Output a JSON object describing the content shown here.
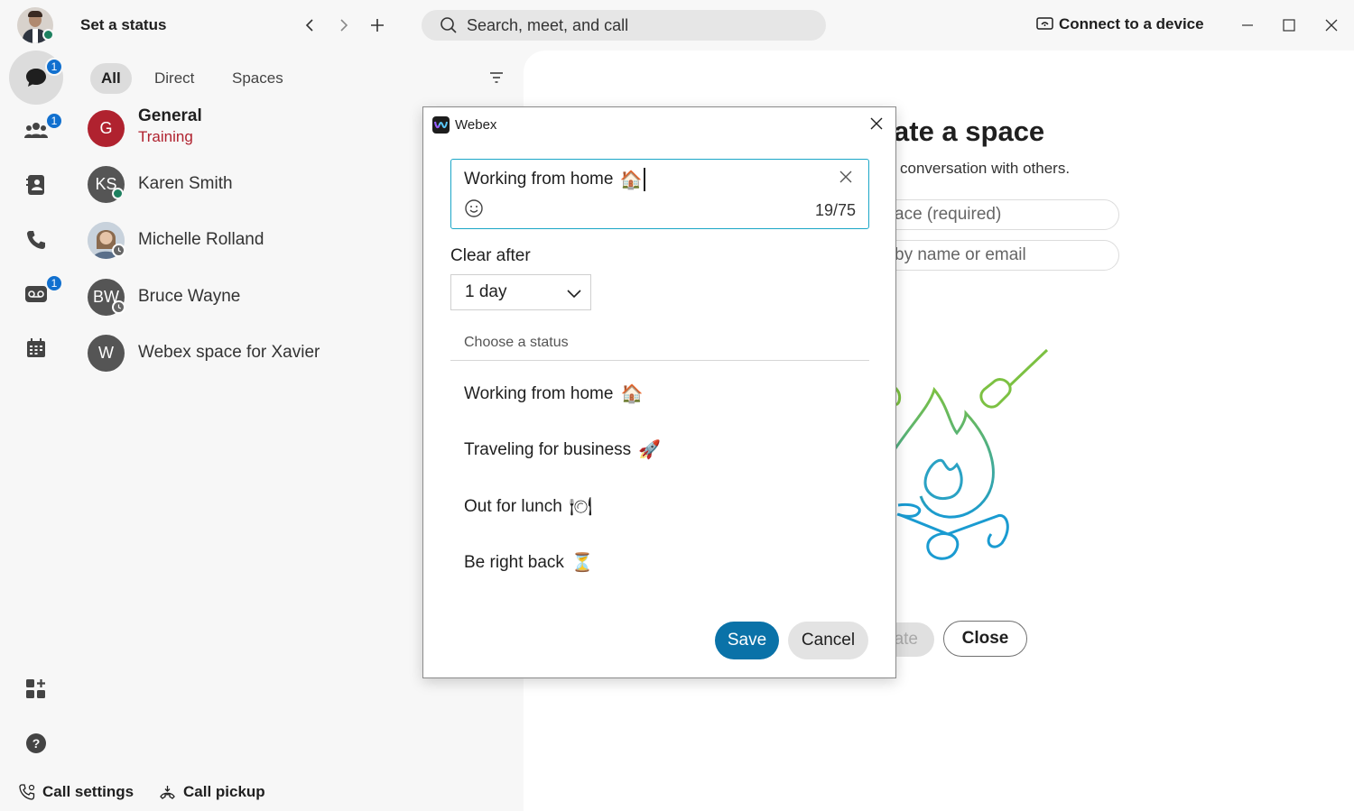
{
  "header": {
    "status_label": "Set a status",
    "search_placeholder": "Search, meet, and call",
    "connect_label": "Connect to a device"
  },
  "rail": {
    "messaging_badge": "1",
    "teams_badge": "1",
    "voicemail_badge": "1"
  },
  "filters": {
    "all": "All",
    "direct": "Direct",
    "spaces": "Spaces"
  },
  "conversations": [
    {
      "initials": "G",
      "name": "General",
      "sub": "Training",
      "color": "#b0222f"
    },
    {
      "initials": "KS",
      "name": "Karen Smith",
      "color": "#555555"
    },
    {
      "initials": "",
      "name": "Michelle Rolland",
      "color": "#9aa7b4"
    },
    {
      "initials": "BW",
      "name": "Bruce Wayne",
      "color": "#555555"
    },
    {
      "initials": "W",
      "name": "Webex space for Xavier",
      "color": "#555555"
    }
  ],
  "footer": {
    "call_settings": "Call settings",
    "call_pickup": "Call pickup"
  },
  "background": {
    "title": "ate a space",
    "subtitle": "conversation with others.",
    "space_name_placeholder": "ace (required)",
    "people_placeholder": "by name or email",
    "create_label": "ate",
    "close_label": "Close"
  },
  "dialog": {
    "title": "Webex",
    "status_value": "Working from home",
    "status_emoji": "🏠",
    "counter": "19/75",
    "clear_after_label": "Clear after",
    "clear_after_value": "1 day",
    "choose_label": "Choose a status",
    "options": [
      {
        "label": "Working from home",
        "emoji": "🏠"
      },
      {
        "label": "Traveling for business",
        "emoji": "🚀"
      },
      {
        "label": "Out for lunch",
        "emoji": "🍽"
      },
      {
        "label": "Be right back",
        "emoji": "⏳"
      }
    ],
    "save_label": "Save",
    "cancel_label": "Cancel"
  },
  "colors": {
    "accent": "#0a72a8",
    "focus_border": "#1aa6c7",
    "badge": "#1170cf",
    "presence_available": "#1d805f"
  }
}
